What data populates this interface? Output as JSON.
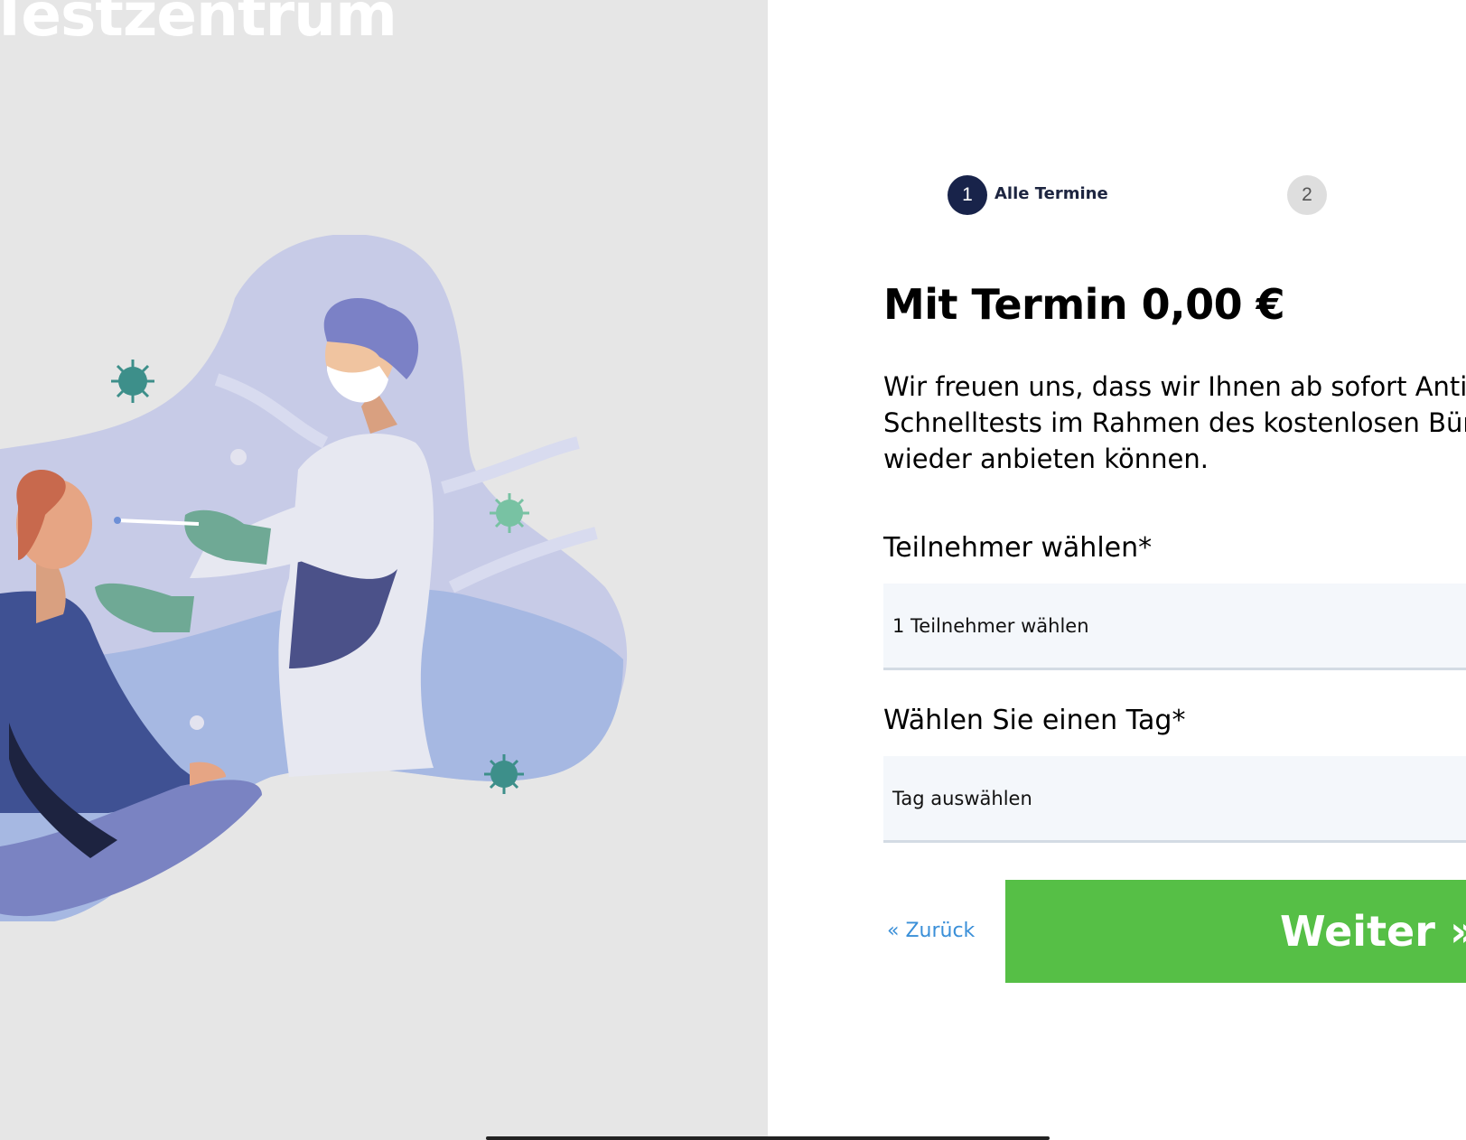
{
  "brand": {
    "logo_text": "Testzentrum"
  },
  "steps": [
    {
      "number": "1",
      "label": "Alle Termine",
      "active": true
    },
    {
      "number": "2",
      "active": false
    }
  ],
  "main": {
    "title": "Mit Termin 0,00 €",
    "intro": "Wir freuen uns, dass wir Ihnen ab sofort Antigen-Schnelltests im Rahmen des kostenlosen Bürgertests wieder anbieten können."
  },
  "form": {
    "participants": {
      "label": "Teilnehmer wählen*",
      "value": "1 Teilnehmer wählen"
    },
    "day": {
      "label": "Wählen Sie einen Tag*",
      "value": "Tag auswählen"
    }
  },
  "actions": {
    "back_label": "« Zurück",
    "next_label": "Weiter »"
  },
  "colors": {
    "left_bg": "#e6e6e6",
    "step_active": "#18234a",
    "step_inactive": "#dedede",
    "primary_button": "#56bf46",
    "link": "#3a8fd8",
    "field_bg": "#f4f7fb"
  },
  "illustration": {
    "icon": "nasal-swab-test-illustration"
  }
}
